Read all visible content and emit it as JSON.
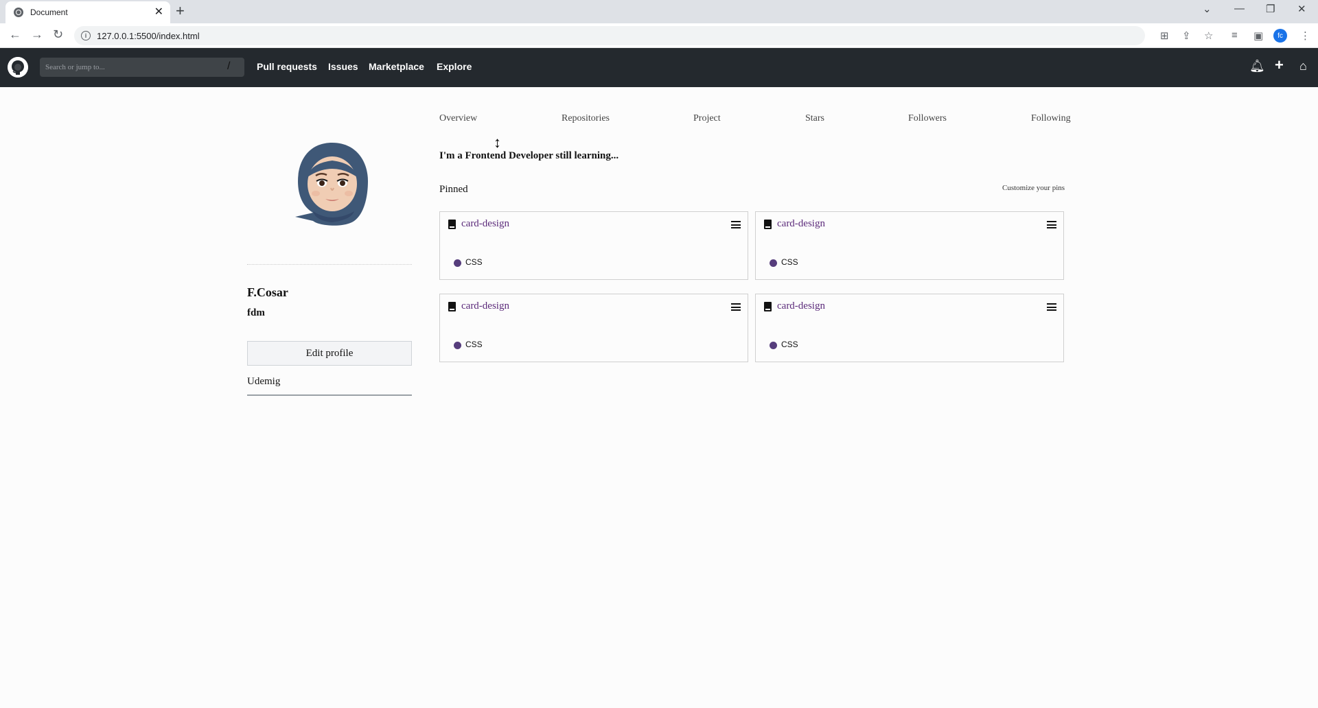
{
  "browser": {
    "tab_title": "Document",
    "tab_close": "✕",
    "new_tab": "+",
    "url": "127.0.0.1:5500/index.html",
    "profile_initials": "fc"
  },
  "header": {
    "search_placeholder": "Search or jump to...",
    "nav": [
      "Pull requests",
      "Issues",
      "Marketplace",
      "Explore"
    ]
  },
  "profile": {
    "full_name": "F.Cosar",
    "username": "fdm",
    "edit_button": "Edit profile",
    "organization": "Udemig"
  },
  "tabs": [
    "Overview",
    "Repositories",
    "Project",
    "Stars",
    "Followers",
    "Following"
  ],
  "bio": "I'm a Frontend Developer still learning...",
  "pinned": {
    "label": "Pinned",
    "customize": "Customize your pins",
    "cards": [
      {
        "name": "card-design",
        "language": "CSS"
      },
      {
        "name": "card-design",
        "language": "CSS"
      },
      {
        "name": "card-design",
        "language": "CSS"
      },
      {
        "name": "card-design",
        "language": "CSS"
      }
    ]
  },
  "colors": {
    "header_bg": "#24292e",
    "repo_link": "#5b2a7a",
    "css_language": "#563d7c"
  },
  "icons": {
    "cursor": "↕"
  }
}
